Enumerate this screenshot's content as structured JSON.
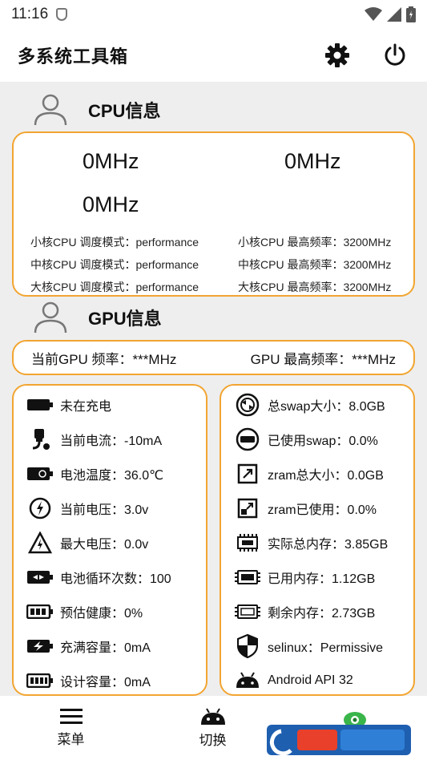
{
  "status_bar": {
    "time": "11:16"
  },
  "app": {
    "title": "多系统工具箱"
  },
  "cpu": {
    "title": "CPU信息",
    "freqs": [
      "0MHz",
      "0MHz",
      "0MHz"
    ],
    "lines_left": [
      "小核CPU 调度模式：performance",
      "中核CPU 调度模式：performance",
      "大核CPU 调度模式：performance"
    ],
    "lines_right": [
      "小核CPU 最高频率：3200MHz",
      "中核CPU 最高频率：3200MHz",
      "大核CPU 最高频率：3200MHz"
    ]
  },
  "gpu": {
    "title": "GPU信息",
    "current": "当前GPU 频率：***MHz",
    "max": "GPU 最高频率：***MHz"
  },
  "battery": [
    {
      "icon": "battery-icon",
      "text": "未在充电"
    },
    {
      "icon": "plug-icon",
      "text": "当前电流：-10mA"
    },
    {
      "icon": "battery-temp-icon",
      "text": "电池温度：36.0℃"
    },
    {
      "icon": "voltage-icon",
      "text": "当前电压：3.0v"
    },
    {
      "icon": "warning-voltage-icon",
      "text": "最大电压：0.0v"
    },
    {
      "icon": "battery-cycle-icon",
      "text": "电池循环次数：100"
    },
    {
      "icon": "battery-health-icon",
      "text": "预估健康：0%"
    },
    {
      "icon": "charge-capacity-icon",
      "text": "充满容量：0mA"
    },
    {
      "icon": "design-capacity-icon",
      "text": "设计容量：0mA"
    }
  ],
  "memory": [
    {
      "icon": "swap-icon",
      "text": "总swap大小：8.0GB"
    },
    {
      "icon": "swap-used-icon",
      "text": "已使用swap：0.0%"
    },
    {
      "icon": "zram-total-icon",
      "text": "zram总大小：0.0GB"
    },
    {
      "icon": "zram-used-icon",
      "text": "zram已使用：0.0%"
    },
    {
      "icon": "ram-icon",
      "text": "实际总内存：3.85GB"
    },
    {
      "icon": "chip-icon",
      "text": "已用内存：1.12GB"
    },
    {
      "icon": "chip-icon",
      "text": "剩余内存：2.73GB"
    },
    {
      "icon": "selinux-shield-icon",
      "text": "selinux：Permissive"
    },
    {
      "icon": "android-icon",
      "text": "Android API 32"
    }
  ],
  "nav": {
    "menu": "菜单",
    "switch": "切换"
  },
  "colors": {
    "accent": "#f2a531",
    "background": "#eeeeee",
    "card": "#ffffff"
  }
}
